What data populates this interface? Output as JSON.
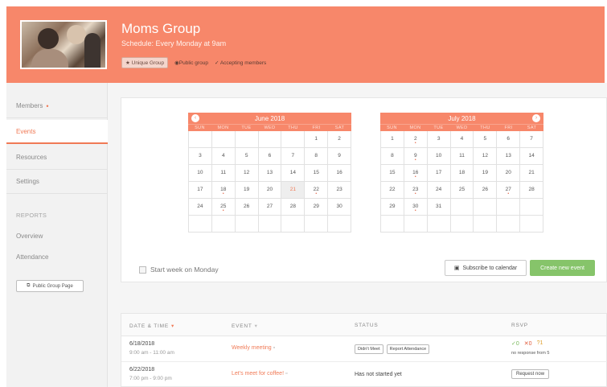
{
  "header": {
    "title": "Moms Group",
    "schedule": "Schedule: Every Monday at 9am",
    "tags": {
      "unique": "Unique Group",
      "public": "Public group",
      "accepting": "Accepting members"
    }
  },
  "sidebar": {
    "items": [
      {
        "label": "Members"
      },
      {
        "label": "Events"
      },
      {
        "label": "Resources"
      },
      {
        "label": "Settings"
      }
    ],
    "reports_heading": "REPORTS",
    "report_items": [
      {
        "label": "Overview"
      },
      {
        "label": "Attendance"
      }
    ],
    "public_page_button": "Public Group Page"
  },
  "calendar": {
    "weekdays": [
      "SUN",
      "MON",
      "TUE",
      "WED",
      "THU",
      "FRI",
      "SAT"
    ],
    "months": [
      {
        "title": "June 2018",
        "weeks": [
          [
            "",
            "",
            "",
            "",
            "",
            "1",
            "2"
          ],
          [
            "3",
            "4",
            "5",
            "6",
            "7",
            "8",
            "9"
          ],
          [
            "10",
            "11",
            "12",
            "13",
            "14",
            "15",
            "16"
          ],
          [
            "17",
            "18",
            "19",
            "20",
            "21",
            "22",
            "23"
          ],
          [
            "24",
            "25",
            "26",
            "27",
            "28",
            "29",
            "30"
          ],
          [
            "",
            "",
            "",
            "",
            "",
            "",
            ""
          ]
        ],
        "event_days": [
          "18",
          "22",
          "25"
        ],
        "selected_day": "21"
      },
      {
        "title": "July 2018",
        "weeks": [
          [
            "1",
            "2",
            "3",
            "4",
            "5",
            "6",
            "7"
          ],
          [
            "8",
            "9",
            "10",
            "11",
            "12",
            "13",
            "14"
          ],
          [
            "15",
            "16",
            "17",
            "18",
            "19",
            "20",
            "21"
          ],
          [
            "22",
            "23",
            "24",
            "25",
            "26",
            "27",
            "28"
          ],
          [
            "29",
            "30",
            "31",
            "",
            "",
            "",
            ""
          ],
          [
            "",
            "",
            "",
            "",
            "",
            "",
            ""
          ]
        ],
        "event_days": [
          "2",
          "9",
          "16",
          "23",
          "27",
          "30"
        ],
        "selected_day": ""
      }
    ],
    "start_week_label": "Start week on Monday",
    "subscribe_label": "Subscribe to calendar",
    "create_label": "Create new event"
  },
  "events_table": {
    "headers": {
      "date": "DATE & TIME",
      "event": "EVENT",
      "status": "STATUS",
      "rsvp": "RSVP"
    },
    "rows": [
      {
        "date": "6/18/2018",
        "time": "9:00 am - 11:00 am",
        "event": "Weekly meeting",
        "status_buttons": [
          "Didn't Meet",
          "Report Attendance"
        ],
        "rsvp_yes": "0",
        "rsvp_no": "0",
        "rsvp_maybe": "1",
        "rsvp_note": "no response from 5"
      },
      {
        "date": "6/22/2018",
        "time": "7:00 pm - 9:00 pm",
        "event": "Let's meet for coffee!",
        "status_text": "Has not started yet",
        "request_label": "Request now"
      }
    ]
  },
  "colors": {
    "accent": "#f7876a",
    "create_green": "#86c46a",
    "link": "#f07a56"
  }
}
